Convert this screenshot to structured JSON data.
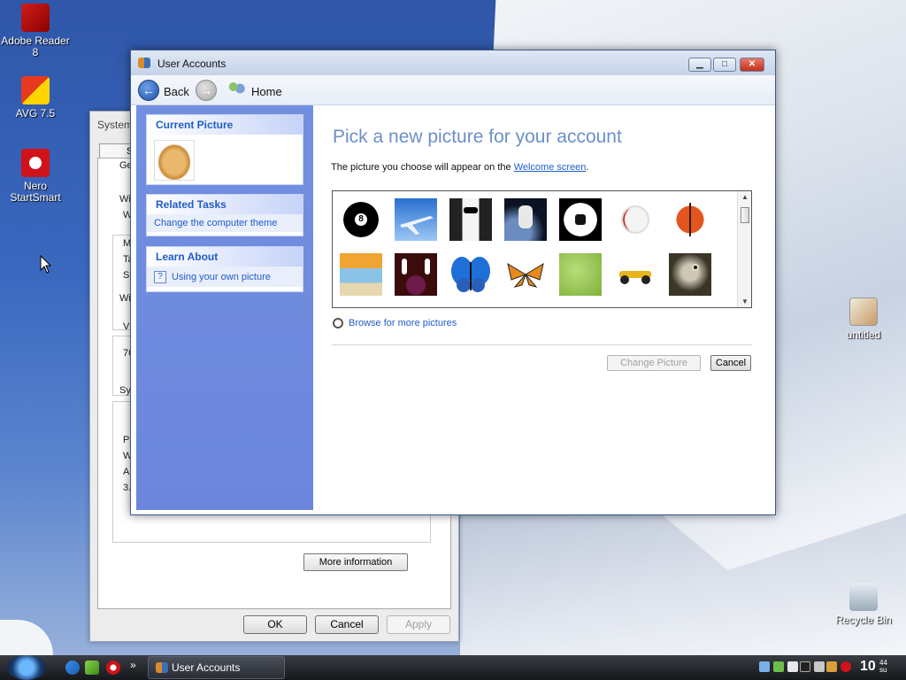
{
  "desktop": {
    "icons": [
      {
        "label": "Adobe Reader 8",
        "icon": "adobe-reader-icon"
      },
      {
        "label": "AVG 7.5",
        "icon": "avg-icon"
      },
      {
        "label": "Nero StartSmart",
        "icon": "nero-icon"
      },
      {
        "label": "untitled",
        "icon": "image-file-icon"
      },
      {
        "label": "Recycle Bin",
        "icon": "recycle-bin-icon"
      }
    ]
  },
  "system_window": {
    "title": "System",
    "tab_fragment": "S",
    "fragments": [
      "Ge",
      "Wi",
      "W",
      "Ma",
      "Ta",
      "Se",
      "Wi",
      "VM",
      "76",
      "Sys",
      "Po",
      "W",
      "AM",
      "3."
    ],
    "more_info_label": "More information",
    "buttons": {
      "ok": "OK",
      "cancel": "Cancel",
      "apply": "Apply"
    }
  },
  "user_accounts": {
    "title": "User Accounts",
    "nav": {
      "back": "Back",
      "home": "Home"
    },
    "sidebar": {
      "current_picture": {
        "heading": "Current Picture",
        "picture": "fortune-cookie"
      },
      "related_tasks": {
        "heading": "Related Tasks",
        "items": [
          "Change the computer theme"
        ]
      },
      "learn_about": {
        "heading": "Learn About",
        "items": [
          "Using your own picture"
        ]
      }
    },
    "main": {
      "heading": "Pick a new picture for your account",
      "desc_prefix": "The picture you choose will appear on the",
      "desc_link": "Welcome screen",
      "desc_suffix": ".",
      "pictures": [
        "8-ball",
        "airplane",
        "tuxedo",
        "astronaut",
        "soccer-ball",
        "baseball",
        "basketball",
        "beach-chairs",
        "bowling",
        "blue-butterfly",
        "orange-butterfly",
        "green-leaf",
        "race-car",
        "owl"
      ],
      "browse_label": "Browse for more pictures",
      "change_label": "Change Picture",
      "cancel_label": "Cancel"
    }
  },
  "taskbar": {
    "task_label": "User Accounts",
    "clock_main": "10",
    "clock_sup": "44",
    "clock_sub": "su"
  },
  "colors": {
    "heading_blue": "#6d8fc9",
    "link_blue": "#215dc6",
    "sidebar_blue": "#7390e0"
  }
}
